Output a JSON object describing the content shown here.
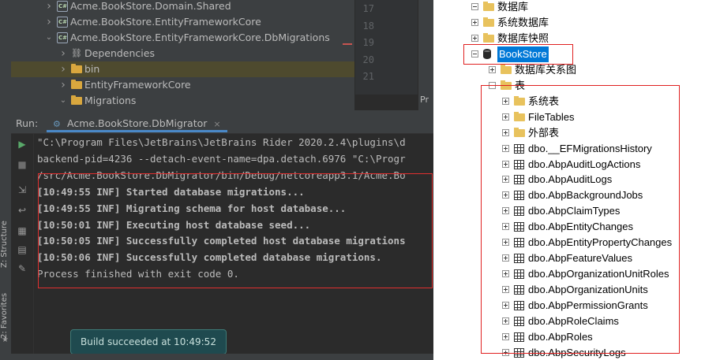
{
  "solution_tree": [
    {
      "label": "Acme.BookStore.Domain.Shared",
      "icon": "csharp-project-icon",
      "expanded": false,
      "indent": 0
    },
    {
      "label": "Acme.BookStore.EntityFrameworkCore",
      "icon": "csharp-project-icon",
      "expanded": false,
      "indent": 0
    },
    {
      "label": "Acme.BookStore.EntityFrameworkCore.DbMigrations",
      "icon": "csharp-project-icon",
      "expanded": true,
      "indent": 0
    },
    {
      "label": "Dependencies",
      "icon": "dependencies-icon",
      "expanded": false,
      "indent": 1
    },
    {
      "label": "bin",
      "icon": "folder-icon",
      "expanded": false,
      "indent": 1,
      "highlighted": true
    },
    {
      "label": "EntityFrameworkCore",
      "icon": "folder-icon",
      "expanded": false,
      "indent": 1
    },
    {
      "label": "Migrations",
      "icon": "folder-icon",
      "expanded": true,
      "indent": 1
    }
  ],
  "editor_gutter_lines": [
    "17",
    "18",
    "19",
    "20",
    "21"
  ],
  "right_panel_label": "Pr",
  "side_tabs": {
    "structure": "Z: Structure",
    "favorites": "2: Favorites"
  },
  "run_panel": {
    "label": "Run:",
    "tab_name": "Acme.BookStore.DbMigrator",
    "tab_close": "×"
  },
  "console_lines": [
    {
      "text": "\"C:\\Program Files\\JetBrains\\JetBrains Rider 2020.2.4\\plugins\\d",
      "bold": false
    },
    {
      "text": "backend-pid=4236 --detach-event-name=dpa.detach.6976 \"C:\\Progr",
      "bold": false
    },
    {
      "text": "/src/Acme.BookStore.DbMigrator/bin/Debug/netcoreapp3.1/Acme.Bo",
      "bold": false
    },
    {
      "text": "[10:49:55 INF] Started database migrations...",
      "bold": true
    },
    {
      "text": "[10:49:55 INF] Migrating schema for host database...",
      "bold": true
    },
    {
      "text": "[10:50:01 INF] Executing host database seed...",
      "bold": true
    },
    {
      "text": "[10:50:05 INF] Successfully completed host database migrations",
      "bold": true
    },
    {
      "text": "[10:50:06 INF] Successfully completed database migrations.",
      "bold": true
    },
    {
      "text": "Process finished with exit code 0.",
      "bold": false
    }
  ],
  "toast": "Build succeeded at 10:49:52",
  "object_explorer": [
    {
      "label": "数据库",
      "icon": "folder",
      "toggle": "minus",
      "indent": 0
    },
    {
      "label": "系统数据库",
      "icon": "folder",
      "toggle": "plus",
      "indent": 1
    },
    {
      "label": "数据库快照",
      "icon": "folder",
      "toggle": "plus",
      "indent": 1
    },
    {
      "label": "BookStore",
      "icon": "database",
      "toggle": "minus",
      "indent": 1,
      "selected": true
    },
    {
      "label": "数据库关系图",
      "icon": "folder",
      "toggle": "plus",
      "indent": 2
    },
    {
      "label": "表",
      "icon": "folder",
      "toggle": "minus",
      "indent": 2
    },
    {
      "label": "系统表",
      "icon": "folder",
      "toggle": "plus",
      "indent": 3
    },
    {
      "label": "FileTables",
      "icon": "folder",
      "toggle": "plus",
      "indent": 3
    },
    {
      "label": "外部表",
      "icon": "folder",
      "toggle": "plus",
      "indent": 3
    },
    {
      "label": "dbo.__EFMigrationsHistory",
      "icon": "table",
      "toggle": "plus",
      "indent": 3
    },
    {
      "label": "dbo.AbpAuditLogActions",
      "icon": "table",
      "toggle": "plus",
      "indent": 3
    },
    {
      "label": "dbo.AbpAuditLogs",
      "icon": "table",
      "toggle": "plus",
      "indent": 3
    },
    {
      "label": "dbo.AbpBackgroundJobs",
      "icon": "table",
      "toggle": "plus",
      "indent": 3
    },
    {
      "label": "dbo.AbpClaimTypes",
      "icon": "table",
      "toggle": "plus",
      "indent": 3
    },
    {
      "label": "dbo.AbpEntityChanges",
      "icon": "table",
      "toggle": "plus",
      "indent": 3
    },
    {
      "label": "dbo.AbpEntityPropertyChanges",
      "icon": "table",
      "toggle": "plus",
      "indent": 3
    },
    {
      "label": "dbo.AbpFeatureValues",
      "icon": "table",
      "toggle": "plus",
      "indent": 3
    },
    {
      "label": "dbo.AbpOrganizationUnitRoles",
      "icon": "table",
      "toggle": "plus",
      "indent": 3
    },
    {
      "label": "dbo.AbpOrganizationUnits",
      "icon": "table",
      "toggle": "plus",
      "indent": 3
    },
    {
      "label": "dbo.AbpPermissionGrants",
      "icon": "table",
      "toggle": "plus",
      "indent": 3
    },
    {
      "label": "dbo.AbpRoleClaims",
      "icon": "table",
      "toggle": "plus",
      "indent": 3
    },
    {
      "label": "dbo.AbpRoles",
      "icon": "table",
      "toggle": "plus",
      "indent": 3
    },
    {
      "label": "dbo.AbpSecurityLogs",
      "icon": "table",
      "toggle": "plus",
      "indent": 3
    }
  ],
  "colors": {
    "ide_bg": "#2b2b2b",
    "ide_panel": "#3c3f41",
    "highlight_red": "#e02020",
    "selection_blue": "#0078d7",
    "toast_bg": "#1f4a4f",
    "run_green": "#59a869"
  }
}
